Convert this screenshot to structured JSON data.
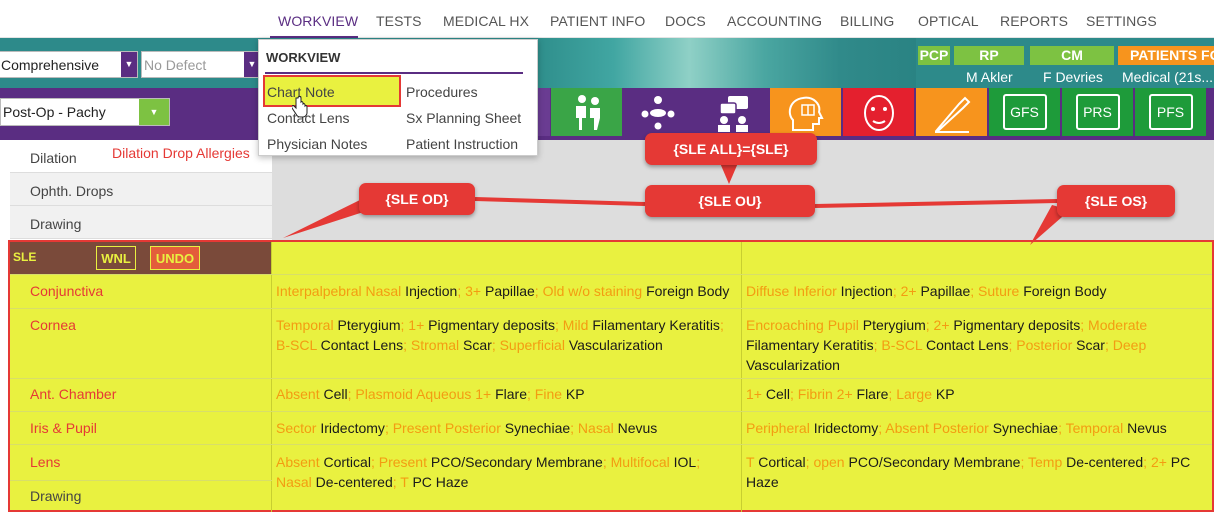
{
  "nav": {
    "items": [
      "WORKVIEW",
      "TESTS",
      "MEDICAL HX",
      "PATIENT INFO",
      "DOCS",
      "ACCOUNTING",
      "BILLING",
      "OPTICAL",
      "REPORTS",
      "SETTINGS"
    ]
  },
  "toolbar": {
    "exam_type": "Comprehensive",
    "defect": "No Defect",
    "template": "Post-Op - Pachy",
    "providers": {
      "pcp_label": "PCP",
      "rp_label": "RP",
      "rp_name": "M Akler",
      "cm_label": "CM",
      "cm_name": "F Devries",
      "patients_label": "PATIENTS FO",
      "patients_value": "Medical (21s..."
    },
    "tiles": [
      "GFS",
      "PRS",
      "PFS"
    ]
  },
  "menu": {
    "title": "WORKVIEW",
    "col1": [
      "Chart Note",
      "Contact Lens",
      "Physician Notes"
    ],
    "col2": [
      "Procedures",
      "Sx Planning Sheet",
      "Patient Instruction"
    ]
  },
  "left_rows": {
    "dilation": "Dilation",
    "dilation_allergy": "Dilation Drop Allergies",
    "drops": "Ophth. Drops",
    "drawing": "Drawing"
  },
  "sle": {
    "title": "SLE",
    "wnl": "WNL",
    "undo": "UNDO",
    "rows": [
      {
        "label": "Conjunctiva",
        "od": [
          [
            "o",
            "Interpalpebral Nasal"
          ],
          [
            "b",
            " Injection"
          ],
          [
            "o",
            "; 3+"
          ],
          [
            "b",
            " Papillae"
          ],
          [
            "o",
            "; Old w/o staining"
          ],
          [
            "b",
            " Foreign Body"
          ]
        ],
        "os": [
          [
            "o",
            "Diffuse Inferior"
          ],
          [
            "b",
            " Injection"
          ],
          [
            "o",
            "; 2+"
          ],
          [
            "b",
            " Papillae"
          ],
          [
            "o",
            "; Suture"
          ],
          [
            "b",
            " Foreign Body"
          ]
        ]
      },
      {
        "label": "Cornea",
        "od": [
          [
            "o",
            "Temporal"
          ],
          [
            "b",
            " Pterygium"
          ],
          [
            "o",
            "; 1+"
          ],
          [
            "b",
            " Pigmentary deposits"
          ],
          [
            "o",
            "; Mild"
          ],
          [
            "b",
            " Filamentary Keratitis"
          ],
          [
            "o",
            "; B-SCL"
          ],
          [
            "b",
            " Contact Lens"
          ],
          [
            "o",
            "; Stromal"
          ],
          [
            "b",
            " Scar"
          ],
          [
            "o",
            "; Superficial"
          ],
          [
            "b",
            " Vascularization"
          ]
        ],
        "os": [
          [
            "o",
            "Encroaching Pupil"
          ],
          [
            "b",
            " Pterygium"
          ],
          [
            "o",
            "; 2+"
          ],
          [
            "b",
            " Pigmentary deposits"
          ],
          [
            "o",
            "; Moderate"
          ],
          [
            "b",
            " Filamentary Keratitis"
          ],
          [
            "o",
            "; B-SCL"
          ],
          [
            "b",
            " Contact Lens"
          ],
          [
            "o",
            "; Posterior"
          ],
          [
            "b",
            " Scar"
          ],
          [
            "o",
            "; Deep"
          ],
          [
            "b",
            " Vascularization"
          ]
        ]
      },
      {
        "label": "Ant. Chamber",
        "od": [
          [
            "o",
            "Absent"
          ],
          [
            "b",
            " Cell"
          ],
          [
            "o",
            "; Plasmoid Aqueous 1+"
          ],
          [
            "b",
            " Flare"
          ],
          [
            "o",
            "; Fine"
          ],
          [
            "b",
            " KP"
          ]
        ],
        "os": [
          [
            "o",
            "1+"
          ],
          [
            "b",
            " Cell"
          ],
          [
            "o",
            "; Fibrin 2+"
          ],
          [
            "b",
            " Flare"
          ],
          [
            "o",
            "; Large"
          ],
          [
            "b",
            " KP"
          ]
        ]
      },
      {
        "label": "Iris & Pupil",
        "od": [
          [
            "o",
            "Sector"
          ],
          [
            "b",
            " Iridectomy"
          ],
          [
            "o",
            "; Present Posterior"
          ],
          [
            "b",
            " Synechiae"
          ],
          [
            "o",
            "; Nasal"
          ],
          [
            "b",
            " Nevus"
          ]
        ],
        "os": [
          [
            "o",
            "Peripheral"
          ],
          [
            "b",
            " Iridectomy"
          ],
          [
            "o",
            "; Absent Posterior"
          ],
          [
            "b",
            " Synechiae"
          ],
          [
            "o",
            "; Temporal"
          ],
          [
            "b",
            " Nevus"
          ]
        ]
      },
      {
        "label": "Lens",
        "od": [
          [
            "o",
            "Absent"
          ],
          [
            "b",
            " Cortical"
          ],
          [
            "o",
            "; Present"
          ],
          [
            "b",
            " PCO/Secondary Membrane"
          ],
          [
            "o",
            "; Multifocal"
          ],
          [
            "b",
            " IOL"
          ],
          [
            "o",
            "; Nasal"
          ],
          [
            "b",
            " De-centered"
          ],
          [
            "o",
            "; T"
          ],
          [
            "b",
            " PC Haze"
          ]
        ],
        "os": [
          [
            "o",
            "T"
          ],
          [
            "b",
            " Cortical"
          ],
          [
            "o",
            "; open"
          ],
          [
            "b",
            " PCO/Secondary Membrane"
          ],
          [
            "o",
            "; Temp"
          ],
          [
            "b",
            " De-centered"
          ],
          [
            "o",
            "; 2+"
          ],
          [
            "b",
            " PC Haze"
          ]
        ]
      }
    ],
    "drawing_label": "Drawing"
  },
  "callouts": {
    "all": "{SLE ALL}={SLE}",
    "od": "{SLE OD}",
    "ou": "{SLE OU}",
    "os": "{SLE OS}"
  },
  "colors": {
    "brand_purple": "#5a2d82",
    "teal": "#2d8a8a",
    "highlight_yellow": "#e9f140",
    "annotation_red": "#e53935",
    "finding_orange": "#f39c12"
  }
}
